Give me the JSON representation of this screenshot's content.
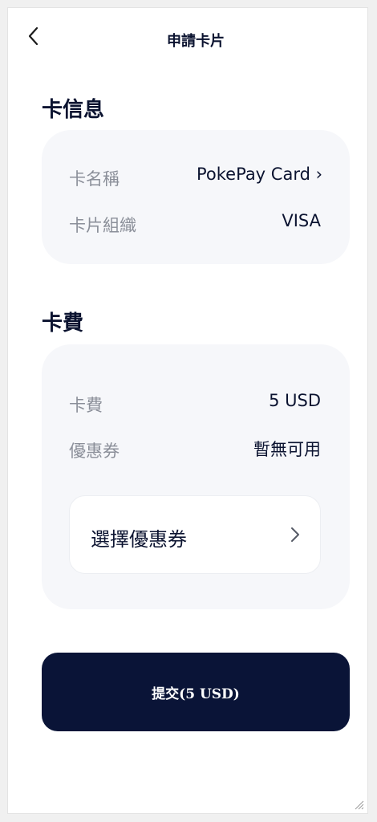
{
  "header": {
    "title": "申請卡片"
  },
  "card_info": {
    "section_title": "卡信息",
    "rows": [
      {
        "label": "卡名稱",
        "value": "PokePay Card ›"
      },
      {
        "label": "卡片組織",
        "value": "VISA"
      }
    ]
  },
  "card_fee": {
    "section_title": "卡費",
    "rows": [
      {
        "label": "卡費",
        "value": "5 USD"
      },
      {
        "label": "優惠券",
        "value": "暫無可用"
      }
    ],
    "select_coupon_label": "選擇優惠券"
  },
  "submit": {
    "label": "提交(5 USD)"
  },
  "icons": {
    "back": "chevron-left-icon",
    "coupon_arrow": "chevron-right-icon",
    "resize": "resize-grip-icon"
  },
  "colors": {
    "primary_dark": "#0a1437",
    "card_bg": "#f6f7fa",
    "label_gray": "#8b8f99"
  }
}
